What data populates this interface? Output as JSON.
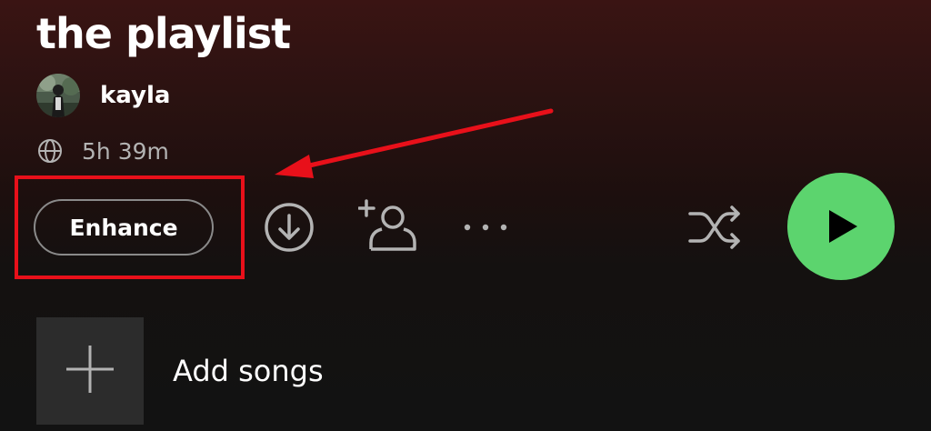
{
  "playlist": {
    "title": "the playlist",
    "owner": "kayla",
    "duration": "5h 39m"
  },
  "actions": {
    "enhance_label": "Enhance",
    "icons": [
      "download-icon",
      "add-user-icon",
      "more-options-icon",
      "shuffle-icon",
      "play-icon"
    ]
  },
  "add_songs": {
    "label": "Add songs",
    "icon": "plus-icon"
  },
  "colors": {
    "play_button": "#5cd46e",
    "annotation": "#e8101a",
    "header_gradient_top": "#3a1413",
    "background": "#121212",
    "secondary_text": "#b3b3b3"
  }
}
